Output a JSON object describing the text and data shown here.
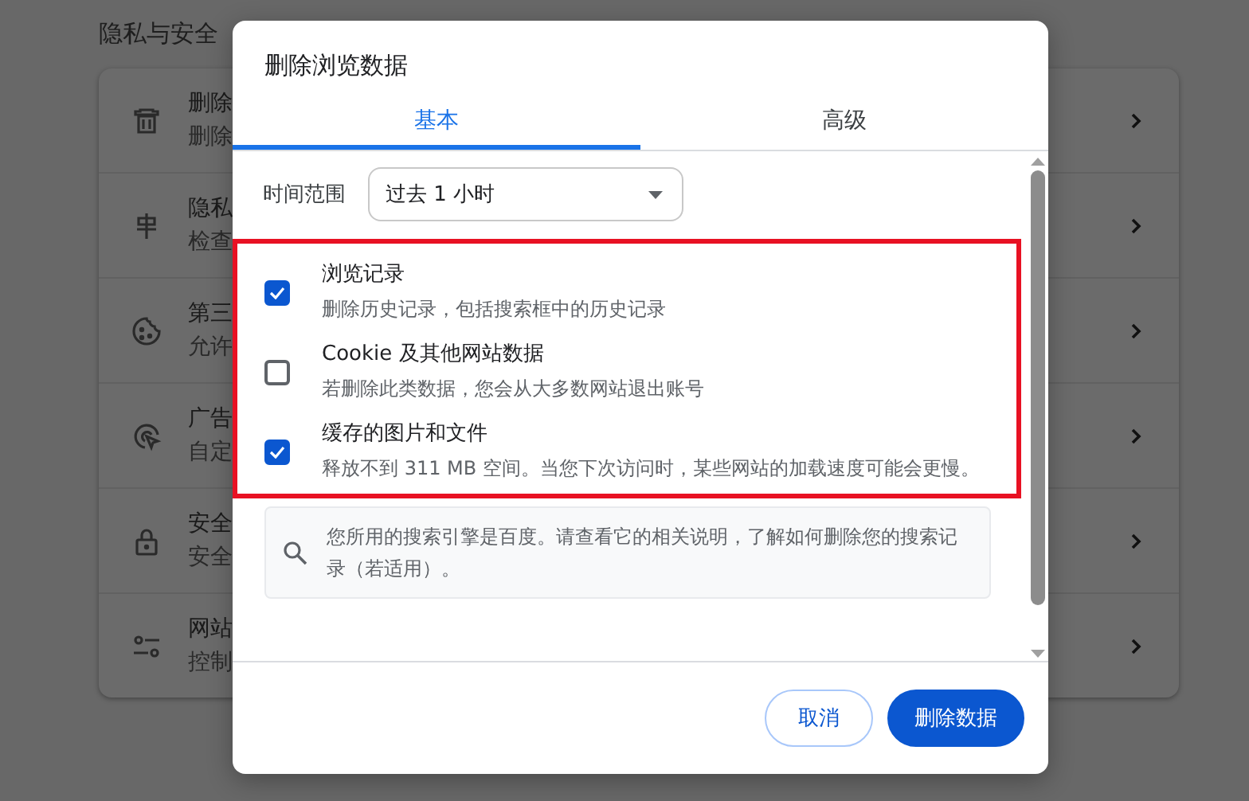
{
  "settings": {
    "section_title": "隐私与安全",
    "rows": [
      {
        "title": "删除",
        "subtitle": "删除"
      },
      {
        "title": "隐私",
        "subtitle": "检查"
      },
      {
        "title": "第三",
        "subtitle": "允许"
      },
      {
        "title": "广告",
        "subtitle": "自定"
      },
      {
        "title": "安全",
        "subtitle": "安全"
      },
      {
        "title": "网站",
        "subtitle": "控制"
      }
    ]
  },
  "dialog": {
    "title": "删除浏览数据",
    "tabs": [
      {
        "label": "基本",
        "selected": true
      },
      {
        "label": "高级",
        "selected": false
      }
    ],
    "time_range": {
      "label": "时间范围",
      "value": "过去 1 小时"
    },
    "options": [
      {
        "title": "浏览记录",
        "description": "删除历史记录，包括搜索框中的历史记录",
        "checked": true
      },
      {
        "title": "Cookie 及其他网站数据",
        "description": "若删除此类数据，您会从大多数网站退出账号",
        "checked": false
      },
      {
        "title": "缓存的图片和文件",
        "description": "释放不到 311 MB 空间。当您下次访问时，某些网站的加载速度可能会更慢。",
        "checked": true
      }
    ],
    "info": {
      "text": "您所用的搜索引擎是百度。请查看它的相关说明，了解如何删除您的搜索记录（若适用）。"
    },
    "buttons": [
      {
        "label": "取消",
        "kind": "secondary"
      },
      {
        "label": "删除数据",
        "kind": "primary"
      }
    ]
  }
}
